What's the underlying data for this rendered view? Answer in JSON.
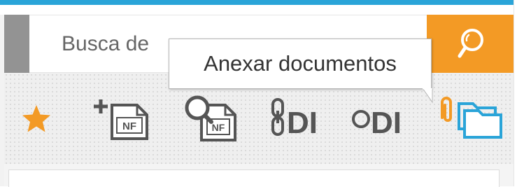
{
  "search": {
    "placeholder": "Busca de",
    "button_icon": "search-icon"
  },
  "tooltip": {
    "text": "Anexar documentos"
  },
  "toolbar": {
    "items": [
      {
        "name": "favorites",
        "icon": "star-icon"
      },
      {
        "name": "add-nf",
        "icon": "add-nf-icon",
        "label": "NF"
      },
      {
        "name": "search-nf",
        "icon": "search-nf-icon",
        "label": "NF"
      },
      {
        "name": "link-di",
        "icon": "link-di-icon",
        "label": "DI"
      },
      {
        "name": "unlink-di",
        "icon": "unlink-di-icon",
        "label": "DI"
      },
      {
        "name": "attach-documents",
        "icon": "attach-folder-icon"
      }
    ]
  },
  "colors": {
    "top_bar": "#2aa4d8",
    "search_button": "#f39a25",
    "star": "#f39a25",
    "attach_clip": "#f39a25",
    "attach_folder": "#2aa4d8",
    "icon_gray": "#555555",
    "tooltip_text": "#333333"
  }
}
